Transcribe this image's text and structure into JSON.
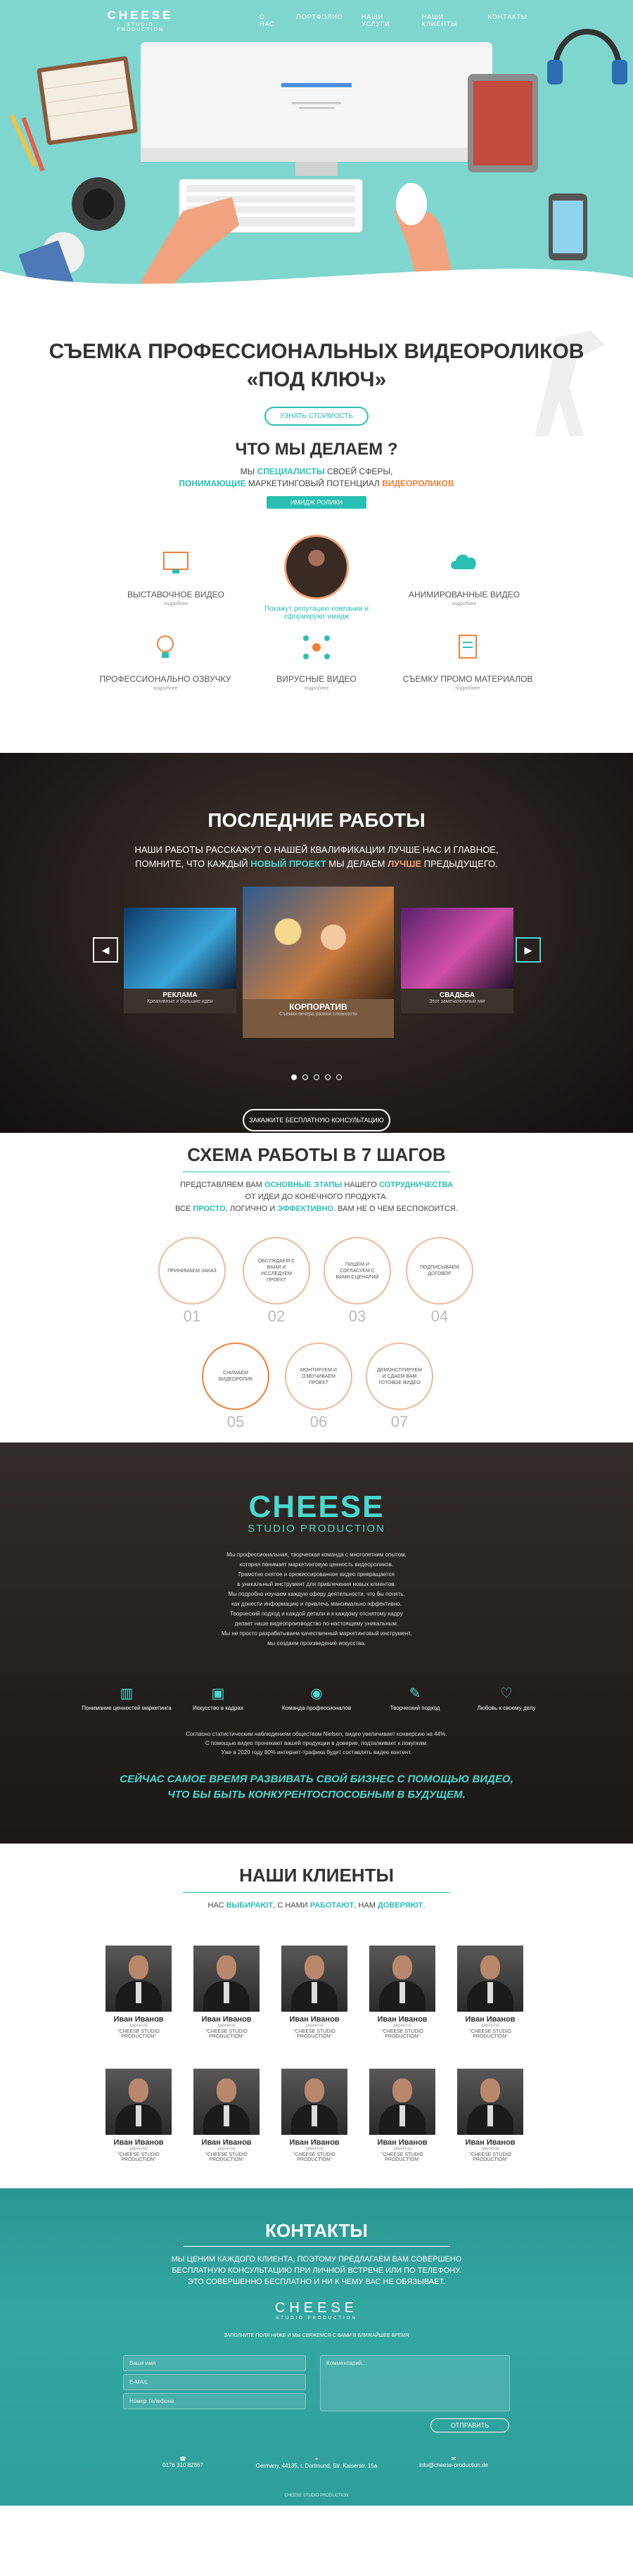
{
  "nav": {
    "logo_main": "CHEESE",
    "logo_sub": "STUDIO PRODUCTION",
    "items": [
      "О НАС",
      "ПОРТФОЛИО",
      "НАШИ УСЛУГИ",
      "НАШИ КЛИЕНТЫ",
      "КОНТАКТЫ"
    ]
  },
  "hero": {
    "title_line1": "СЪЕМКА ПРОФЕССИОНАЛЬНЫХ ВИДЕОРОЛИКОВ",
    "title_line2": "«ПОД КЛЮЧ»",
    "cta": "УЗНАТЬ СТОИМОСТЬ"
  },
  "what": {
    "title": "ЧТО МЫ ДЕЛАЕМ ?",
    "line1_a": "МЫ",
    "line1_b": "СПЕЦИАЛИСТЫ",
    "line1_c": "СВОЕЙ СФЕРЫ,",
    "line2_a": "ПОНИМАЮЩИЕ",
    "line2_b": "МАРКЕТИНГОВЫЙ ПОТЕНЦИАЛ",
    "line2_c": "ВИДЕОРОЛИКОВ",
    "bar": "ИМИДЖ РОЛИКИ",
    "center_text": "Покажут репутацию компании и сформируют имидж",
    "services": [
      {
        "title": "ВЫСТАВОЧНОЕ ВИДЕО",
        "sub": "подробнее",
        "icon": "monitor-icon"
      },
      {
        "title": "АНИМИРОВАННЫЕ ВИДЕО",
        "sub": "подробнее",
        "icon": "cloud-icon"
      },
      {
        "title": "ПРОФЕССИОНАЛЬНО ОЗВУЧКУ",
        "sub": "подробнее",
        "icon": "lightbulb-icon"
      },
      {
        "title": "ВИРУСНЫЕ ВИДЕО",
        "sub": "подробнее",
        "icon": "network-icon"
      },
      {
        "title": "СЪЕМКУ ПРОМО МАТЕРИАЛОВ",
        "sub": "подробнее",
        "icon": "clipboard-icon"
      }
    ]
  },
  "works": {
    "title": "ПОСЛЕДНИЕ РАБОТЫ",
    "text1": "НАШИ РАБОТЫ РАССКАЖУТ О НАШЕЙ КВАЛИФИКАЦИИ ЛУЧШЕ НАС И ГЛАВНОЕ,",
    "text2_a": "ПОМНИТЕ, ЧТО КАЖДЫЙ",
    "text2_b": "НОВЫЙ ПРОЕКТ",
    "text2_c": "МЫ ДЕЛАЕМ",
    "text2_d": "ЛУЧШЕ",
    "text2_e": "ПРЕДЫДУЩЕГО.",
    "cards": [
      {
        "title": "РЕКЛАМА",
        "sub": "Креативные и большие идеи"
      },
      {
        "title": "КОРПОРАТИВ",
        "sub": "Съемки вечера разной сложности"
      },
      {
        "title": "СВАДЬБА",
        "sub": "Этот замечательный миг"
      }
    ],
    "button": "ЗАКАЖИТЕ БЕСПЛАТНУЮ КОНСУЛЬТАЦИЮ",
    "prev": "◀",
    "next": "▶"
  },
  "steps": {
    "title": "СХЕМА РАБОТЫ В 7 ШАГОВ",
    "l1_a": "ПРЕДСТАВЛЯЕМ ВАМ",
    "l1_b": "ОСНОВНЫЕ ЭТАПЫ",
    "l1_c": "НАШЕГО",
    "l1_d": "СОТРУДНИЧЕСТВА",
    "l2": "ОТ ИДЕИ ДО КОНЕЧНОГО ПРОДУКТА.",
    "l3_a": "ВСЕ",
    "l3_b": "ПРОСТО",
    "l3_c": ", ЛОГИЧНО И",
    "l3_d": "ЭФФЕКТИВНО",
    "l3_e": ". ВАМ НЕ О ЧЕМ БЕСПОКОИТСЯ.",
    "items": [
      {
        "label": "ПРИНИМАЕМ ЗАКАЗ",
        "num": "01"
      },
      {
        "label": "ОБСУЖДАЕМ С ВАМИ И ИССЛЕДУЕМ ПРОЕКТ",
        "num": "02"
      },
      {
        "label": "ПИШЕМ И СОГЛАСУЕМ С ВАМИ СЦЕНАРИЙ",
        "num": "03"
      },
      {
        "label": "ПОДПИСЫВАЕМ ДОГОВОР",
        "num": "04"
      },
      {
        "label": "СНИМАЕМ ВИДЕОРОЛИК",
        "num": "05"
      },
      {
        "label": "МОНТИРУЕМ И ОЗВУЧИВАЕМ ПРОЕКТ",
        "num": "06"
      },
      {
        "label": "ДЕМОНСТРИРУЕМ И СДАЕМ ВАМ ГОТОВОЕ ВИДЕО",
        "num": "07"
      }
    ]
  },
  "about": {
    "logo": "CHEESE",
    "logo_sub": "STUDIO PRODUCTION",
    "paragraph": [
      "Мы профессиональная, творческая команда с многолетним опытом,",
      "которая понимает маркетинговую ценность видеороликов.",
      "Грамотно снятое и срежиссированное видео превращается",
      "в уникальный инструмент для привлечения новых клиентов.",
      "Мы подробно изучаем каждую сферу деятельности, что бы понять,",
      "как донести информацию и привлечь максимально эффективно.",
      "Творческий подход и каждой детали и к каждому отснятому кадру",
      "делает наше видеопроизводство по-настоящему уникальным.",
      "Мы не просто разрабатываем качественный маркетинговый инструмент,",
      "мы создаем произведение искусства."
    ],
    "features": [
      {
        "title": "Понимание ценностей маркетинга",
        "icon": "chart-icon"
      },
      {
        "title": "Искусство в кадрах",
        "icon": "film-icon"
      },
      {
        "title": "Команда профессионалов",
        "icon": "camera-icon"
      },
      {
        "title": "Творческий подход",
        "icon": "palette-icon"
      },
      {
        "title": "Любовь к своему делу",
        "icon": "heart-icon"
      }
    ],
    "p2": [
      "Согласно статистическим наблюдениям обществом Nielsen, видео увеличивает конверсию на 44%.",
      "С помощью видео проникают вашей продукции в доверие, подталкивает к покупкам.",
      "Уже в 2020 году 80% интернет-трафика будет составлять видео контент."
    ],
    "cta1": "СЕЙЧАС САМОЕ ВРЕМЯ РАЗВИВАТЬ СВОЙ БИЗНЕС С ПОМОЩЬЮ ВИДЕО,",
    "cta2": "ЧТО БЫ БЫТЬ КОНКУРЕНТОСПОСОБНЫМ В БУДУЩЕМ."
  },
  "clients": {
    "title": "НАШИ КЛИЕНТЫ",
    "l_a": "НАС",
    "l_b": "ВЫБИРАЮТ",
    "l_c": ", С НАМИ",
    "l_d": "РАБОТАЮТ",
    "l_e": ", НАМ",
    "l_f": "ДОВЕРЯЮТ",
    "l_g": ".",
    "name": "Иван Иванов",
    "role": "директор",
    "company": "\"CHEESE STUDIO PRODUCTION\""
  },
  "contacts": {
    "title": "КОНТАКТЫ",
    "p1": "МЫ ЦЕНИМ КАЖДОГО КЛИЕНТА, ПОЭТОМУ ПРЕДЛАГАЕМ ВАМ СОВЕРШЕНО",
    "p2": "БЕСПЛАТНУЮ КОНСУЛЬТАЦИЮ ПРИ ЛИЧНОЙ ВСТРЕЧЕ ИЛИ ПО ТЕЛЕФОНУ.",
    "p3": "ЭТО СОВЕРШЕННО БЕСПЛАТНО И НИ К ЧЕМУ ВАС НЕ ОБЯЗЫВАЕТ.",
    "logo": "CHEESE",
    "logo_sub": "STUDIO PRODUCTION",
    "form_hint": "ЗАПОЛНИТЕ ПОЛЯ НИЖЕ И МЫ СВЯЖЕМСЯ С ВАМИ В БЛИЖАЙШЕЕ ВРЕМЯ",
    "name_ph": "Ваше имя",
    "email_ph": "E-MAIL",
    "phone_ph": "Номер телефона",
    "comment_ph": "Комментарий...",
    "send": "ОТПРАВИТЬ",
    "phone": "0176 310 82867",
    "address": "Germany, 44135, г. Dortmund, Str. Kaiserstr. 15а",
    "email": "info@cheese-production.de",
    "copyright": "CHEESE STUDIO PRODUCTION",
    "phone_icon": "phone-icon",
    "map_icon": "map-pin-icon",
    "mail_icon": "envelope-icon"
  }
}
